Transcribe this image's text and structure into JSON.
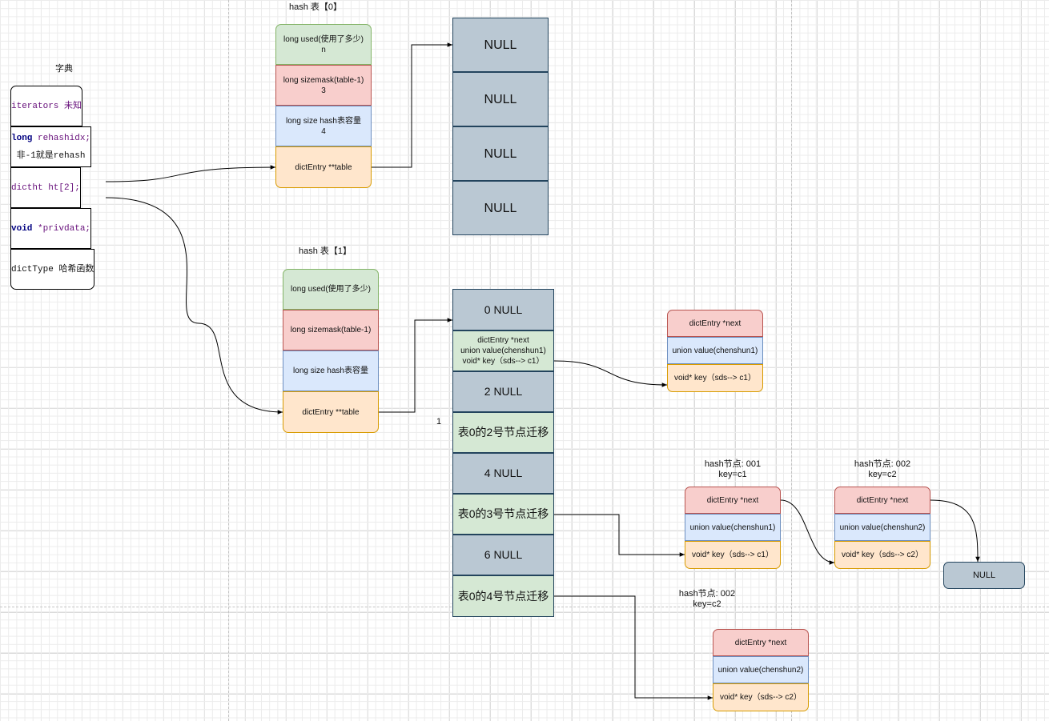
{
  "dict": {
    "title": "字典",
    "rows": [
      {
        "kw": "",
        "text": "iterators 未知"
      },
      {
        "kw": "long",
        "text": " rehashidx;",
        "line2": "非-1就是rehash"
      },
      {
        "kw": "",
        "text": "dictht ht[2];"
      },
      {
        "kw": "void",
        "text": " *privdata;"
      },
      {
        "kw": "",
        "text": "dictType 哈希函数"
      }
    ]
  },
  "ht0": {
    "title": "hash 表【0】",
    "fields": [
      "long used(使用了多少)\nn",
      "long sizemask(table-1)\n3",
      "long size hash表容量\n4",
      "dictEntry **table"
    ],
    "buckets": [
      "NULL",
      "NULL",
      "NULL",
      "NULL"
    ]
  },
  "ht1": {
    "title": "hash 表【1】",
    "fields": [
      "long used(使用了多少)",
      "long sizemask(table-1)",
      "long size hash表容量",
      "dictEntry **table"
    ],
    "buckets": [
      "0 NULL",
      "dictEntry *next\nunion value(chenshun1)\nvoid* key（sds--> c1）",
      "2 NULL",
      "表0的2号节点迁移",
      "4 NULL",
      "表0的3号节点迁移",
      "6 NULL",
      "表0的4号节点迁移"
    ],
    "side_label": "1"
  },
  "entry_top": {
    "fields": [
      "dictEntry *next",
      "union value(chenshun1)",
      "void* key（sds--> c1）"
    ]
  },
  "node_001": {
    "caption": "hash节点: 001\nkey=c1",
    "fields": [
      "dictEntry *next",
      "union value(chenshun1)",
      "void* key（sds--> c1）"
    ]
  },
  "node_002": {
    "caption": "hash节点: 002\nkey=c2",
    "fields": [
      "dictEntry *next",
      "union value(chenshun2)",
      "void* key（sds--> c2）"
    ]
  },
  "null_box": {
    "text": "NULL"
  },
  "node_002b": {
    "caption": "hash节点: 002\nkey=c2",
    "fields": [
      "dictEntry *next",
      "union value(chenshun2)",
      "void* key（sds--> c2）"
    ]
  }
}
